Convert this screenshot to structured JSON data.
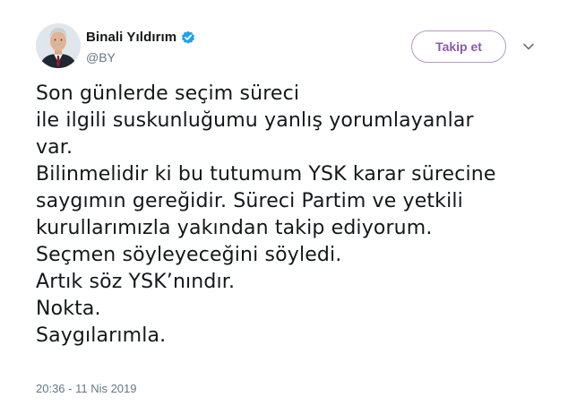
{
  "author": {
    "display_name": "Binali Yıldırım",
    "handle": "@BY",
    "verified": true
  },
  "actions": {
    "follow_label": "Takip et",
    "more_icon": "chevron-down-icon"
  },
  "tweet": {
    "lines": [
      "Son günlerde seçim süreci",
      "ile ilgili suskunluğumu yanlış yorumlayanlar",
      "var.",
      "Bilinmelidir ki bu tutumum YSK karar sürecine",
      "saygımın gereğidir. Süreci Partim ve yetkili",
      "kurullarımızla yakından takip ediyorum.",
      "Seçmen söyleyeceğini söyledi.",
      "Artık söz YSK’nındır.",
      "Nokta.",
      "Saygılarımla."
    ],
    "timestamp": "20:36 - 11 Nis 2019"
  },
  "colors": {
    "verified_blue": "#1da1f2",
    "follow_purple": "#8a5aad",
    "secondary_text": "#657786",
    "primary_text": "#14171a"
  }
}
